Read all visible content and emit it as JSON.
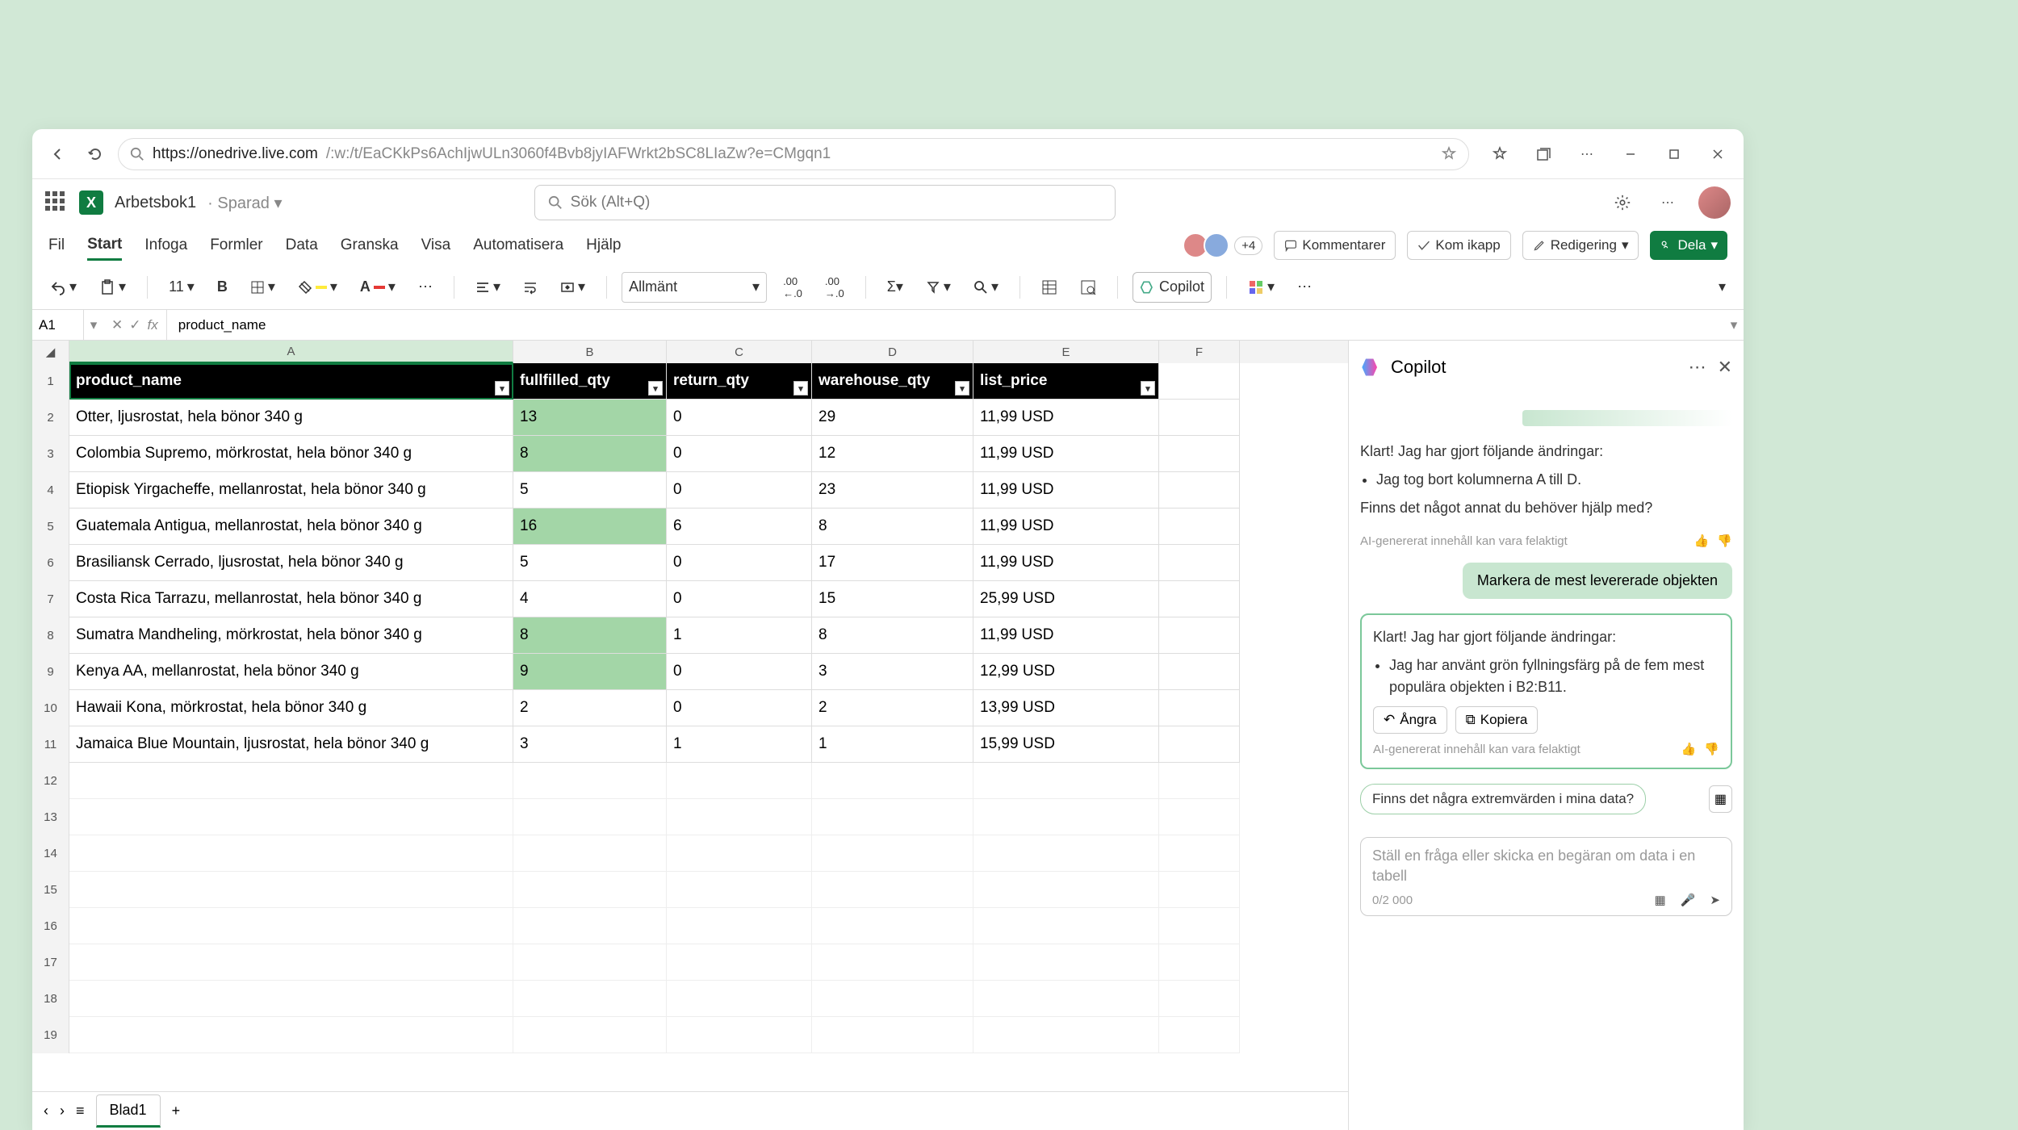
{
  "browser": {
    "url_domain": "https://onedrive.live.com",
    "url_path": "/:w:/t/EaCKkPs6AchIjwULn3060f4Bvb8jyIAFWrkt2bSC8LIaZw?e=CMgqn1"
  },
  "app": {
    "doc_name": "Arbetsbok1",
    "doc_status": "Sparad",
    "search_placeholder": "Sök (Alt+Q)"
  },
  "ribbon": {
    "tabs": [
      "Fil",
      "Start",
      "Infoga",
      "Formler",
      "Data",
      "Granska",
      "Visa",
      "Automatisera",
      "Hjälp"
    ],
    "active": 1,
    "comments": "Kommentarer",
    "catchup": "Kom ikapp",
    "editing": "Redigering",
    "share": "Dela",
    "avatar_overflow": "+4"
  },
  "toolbar": {
    "font_size": "11",
    "num_format": "Allmänt",
    "copilot": "Copilot"
  },
  "formula": {
    "cell": "A1",
    "value": "product_name"
  },
  "grid": {
    "columns": [
      "A",
      "B",
      "C",
      "D",
      "E",
      "F"
    ],
    "headers": [
      "product_name",
      "fullfilled_qty",
      "return_qty",
      "warehouse_qty",
      "list_price"
    ],
    "rows": [
      {
        "n": 2,
        "a": "Otter, ljusrostat, hela bönor 340 g",
        "b": "13",
        "c": "0",
        "d": "29",
        "e": "11,99 USD",
        "hl": true
      },
      {
        "n": 3,
        "a": "Colombia Supremo, mörkrostat, hela bönor 340 g",
        "b": "8",
        "c": "0",
        "d": "12",
        "e": "11,99 USD",
        "hl": true
      },
      {
        "n": 4,
        "a": "Etiopisk Yirgacheffe, mellanrostat, hela bönor 340 g",
        "b": "5",
        "c": "0",
        "d": "23",
        "e": "11,99 USD",
        "hl": false
      },
      {
        "n": 5,
        "a": "Guatemala Antigua, mellanrostat, hela bönor 340 g",
        "b": "16",
        "c": "6",
        "d": "8",
        "e": "11,99 USD",
        "hl": true
      },
      {
        "n": 6,
        "a": "Brasiliansk Cerrado, ljusrostat, hela bönor 340 g",
        "b": "5",
        "c": "0",
        "d": "17",
        "e": "11,99 USD",
        "hl": false
      },
      {
        "n": 7,
        "a": "Costa Rica Tarrazu, mellanrostat, hela bönor 340 g",
        "b": "4",
        "c": "0",
        "d": "15",
        "e": "25,99 USD",
        "hl": false
      },
      {
        "n": 8,
        "a": "Sumatra Mandheling, mörkrostat, hela bönor 340 g",
        "b": "8",
        "c": "1",
        "d": "8",
        "e": "11,99 USD",
        "hl": true
      },
      {
        "n": 9,
        "a": "Kenya AA, mellanrostat, hela bönor 340 g",
        "b": "9",
        "c": "0",
        "d": "3",
        "e": "12,99 USD",
        "hl": true
      },
      {
        "n": 10,
        "a": "Hawaii Kona, mörkrostat, hela bönor 340 g",
        "b": "2",
        "c": "0",
        "d": "2",
        "e": "13,99 USD",
        "hl": false
      },
      {
        "n": 11,
        "a": "Jamaica Blue Mountain, ljusrostat, hela bönor 340 g",
        "b": "3",
        "c": "1",
        "d": "1",
        "e": "15,99 USD",
        "hl": false
      }
    ],
    "empty_rows": [
      12,
      13,
      14,
      15,
      16,
      17,
      18,
      19
    ]
  },
  "copilot": {
    "title": "Copilot",
    "msg1_intro": "Klart! Jag har gjort följande ändringar:",
    "msg1_bullet": "Jag tog bort kolumnerna A till D.",
    "msg1_follow": "Finns det något annat du behöver hjälp med?",
    "ai_note": "AI-genererat innehåll kan vara felaktigt",
    "user_msg": "Markera de mest levererade objekten",
    "msg2_intro": "Klart! Jag har gjort följande ändringar:",
    "msg2_bullet": "Jag har använt grön fyllningsfärg på de fem mest populära objekten i B2:B11.",
    "undo": "Ångra",
    "copy": "Kopiera",
    "suggestion": "Finns det några extremvärden i mina data?",
    "compose_placeholder": "Ställ en fråga eller skicka en begäran om data i en tabell",
    "char_count": "0/2 000"
  },
  "sheet": {
    "name": "Blad1"
  }
}
